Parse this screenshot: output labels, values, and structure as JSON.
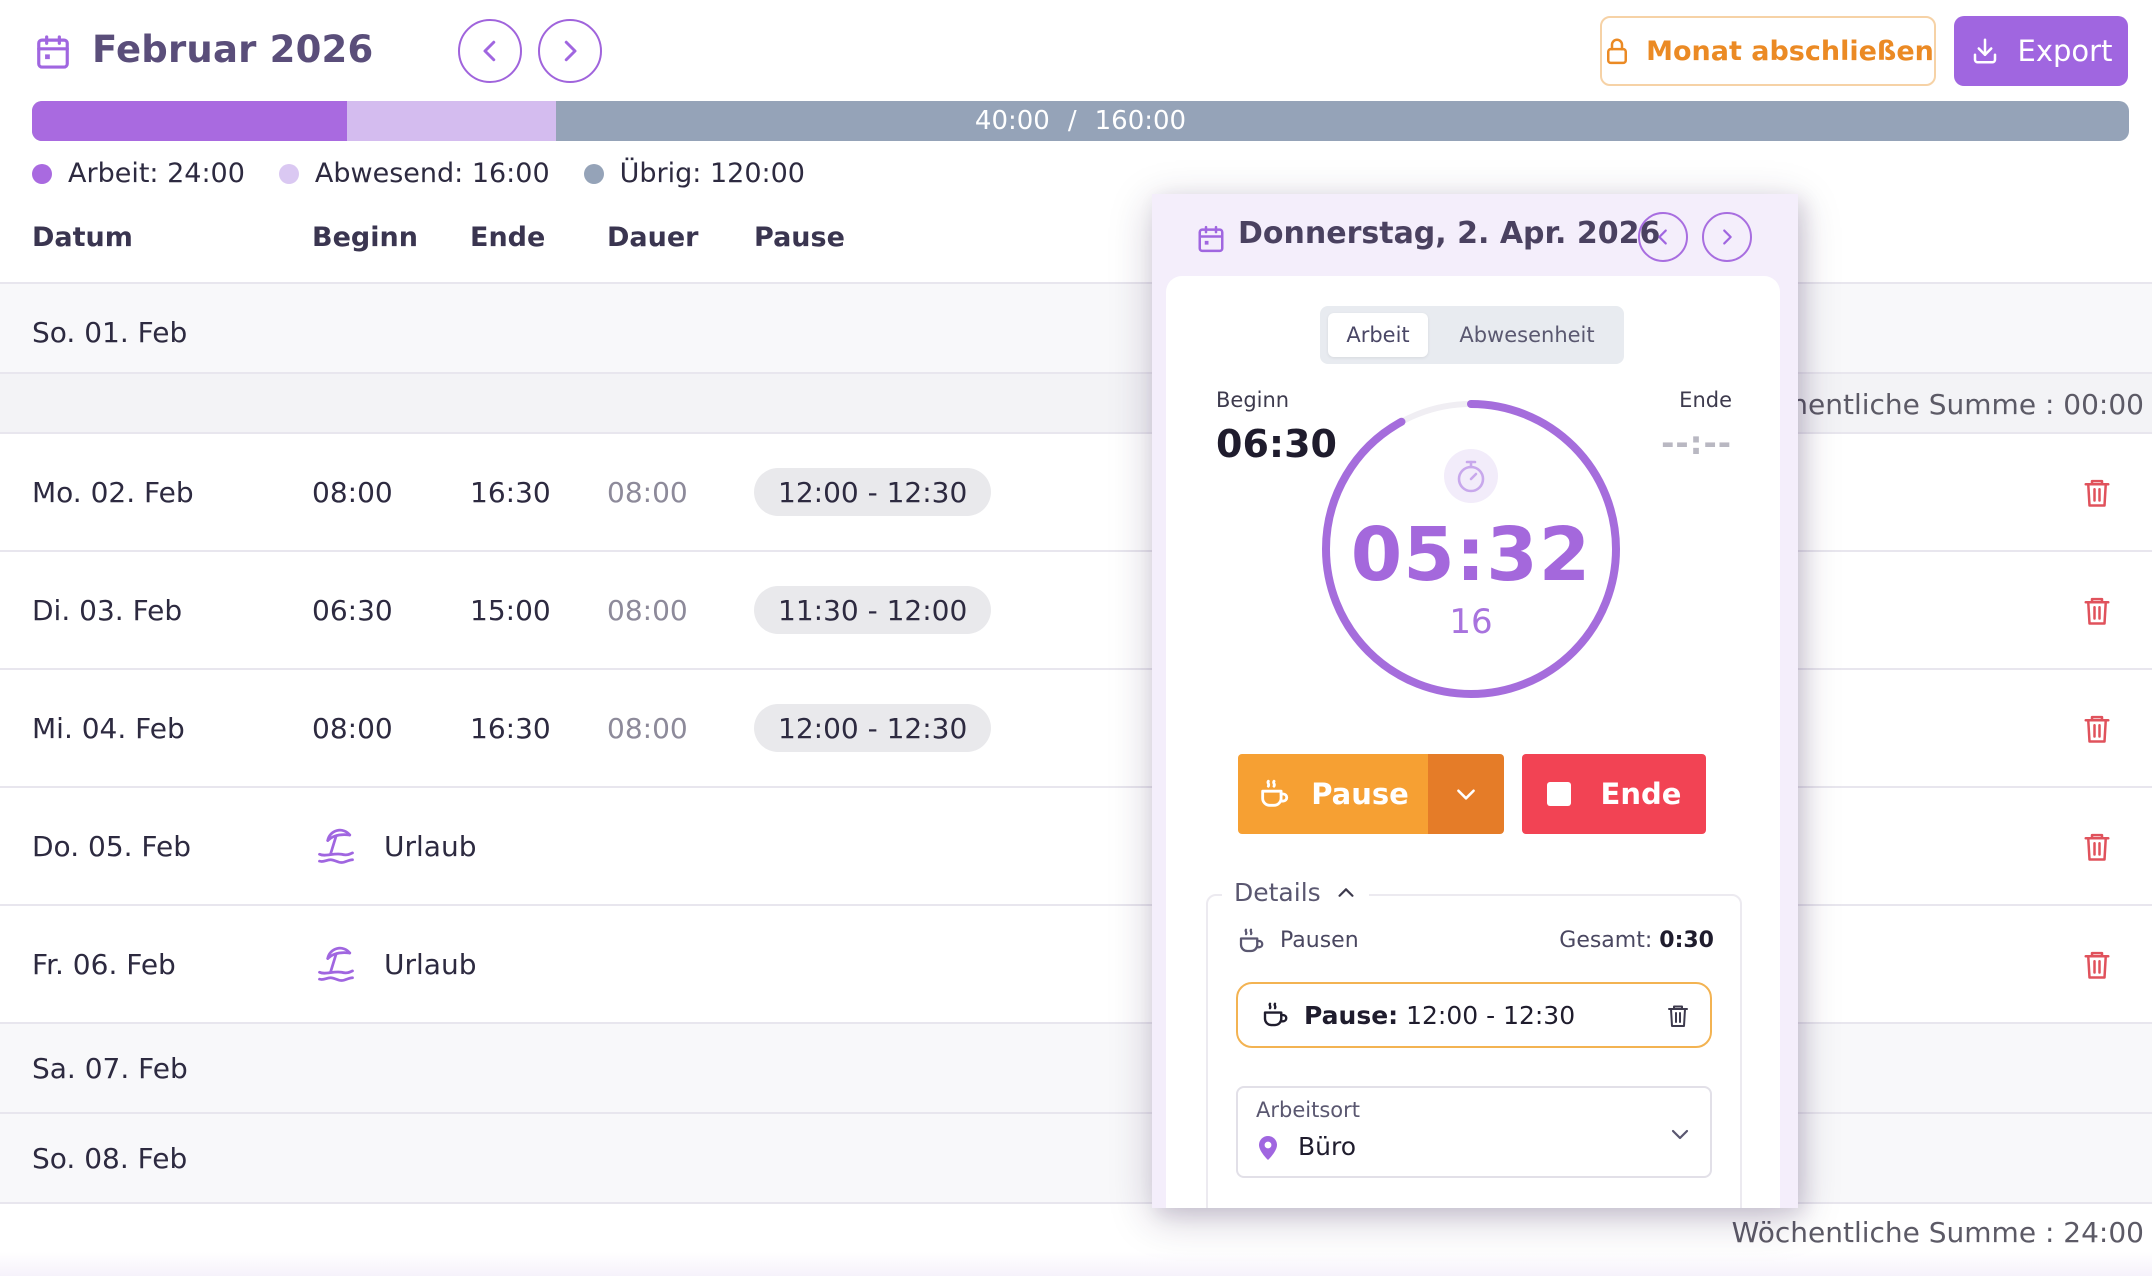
{
  "header": {
    "title": "Februar 2026",
    "lock_button": "Monat abschließen",
    "export_button": "Export"
  },
  "progress": {
    "done": "40:00",
    "separator": "/",
    "total": "160:00",
    "work_fraction": 0.15,
    "absence_fraction": 0.1
  },
  "legend": [
    {
      "label": "Arbeit: 24:00",
      "color": "#a96ae0"
    },
    {
      "label": "Abwesend: 16:00",
      "color": "#dac8f2"
    },
    {
      "label": "Übrig: 120:00",
      "color": "#95a3b8"
    }
  ],
  "table": {
    "headers": {
      "date": "Datum",
      "start": "Beginn",
      "end": "Ende",
      "duration": "Dauer",
      "pause": "Pause"
    },
    "rows": [
      {
        "date": "So. 01. Feb"
      },
      {
        "weekly_sum": "Wöchentliche Summe : 00:00"
      },
      {
        "date": "Mo. 02. Feb",
        "start": "08:00",
        "end": "16:30",
        "duration": "08:00",
        "pause": "12:00 - 12:30"
      },
      {
        "date": "Di. 03. Feb",
        "start": "06:30",
        "end": "15:00",
        "duration": "08:00",
        "pause": "11:30 - 12:00"
      },
      {
        "date": "Mi. 04. Feb",
        "start": "08:00",
        "end": "16:30",
        "duration": "08:00",
        "pause": "12:00 - 12:30"
      },
      {
        "date": "Do. 05. Feb",
        "absence": "Urlaub"
      },
      {
        "date": "Fr. 06. Feb",
        "absence": "Urlaub"
      },
      {
        "date": "Sa. 07. Feb"
      },
      {
        "date": "So. 08. Feb"
      },
      {
        "weekly_sum": "Wöchentliche Summe : 24:00"
      }
    ]
  },
  "panel": {
    "title": "Donnerstag, 2. Apr. 2026",
    "tabs": {
      "active": "Arbeit",
      "inactive": "Abwesenheit"
    },
    "start_label": "Beginn",
    "start_value": "06:30",
    "end_label": "Ende",
    "end_value": "--:--",
    "timer": "05:32",
    "timer_seconds": "16",
    "timer_progress": 0.92,
    "pause_button": "Pause",
    "end_button": "Ende",
    "details_label": "Details",
    "pauses_label": "Pausen",
    "total_label": "Gesamt:",
    "total_value": "0:30",
    "pause_entry_label": "Pause:",
    "pause_entry_value": "12:00 - 12:30",
    "location_label": "Arbeitsort",
    "location_value": "Büro"
  },
  "icons": {
    "calendar": "calendar-icon",
    "chevron_left": "chevron-left-icon",
    "chevron_right": "chevron-right-icon",
    "lock": "lock-icon",
    "download": "download-icon",
    "trash": "trash-icon",
    "beach": "beach-umbrella-icon",
    "coffee": "coffee-cup-icon",
    "stopwatch": "stopwatch-icon",
    "location": "location-pin-icon"
  },
  "colors": {
    "accent": "#a066e0",
    "orange": "#f6a033",
    "red": "#f24354",
    "trash": "#e0525c"
  }
}
